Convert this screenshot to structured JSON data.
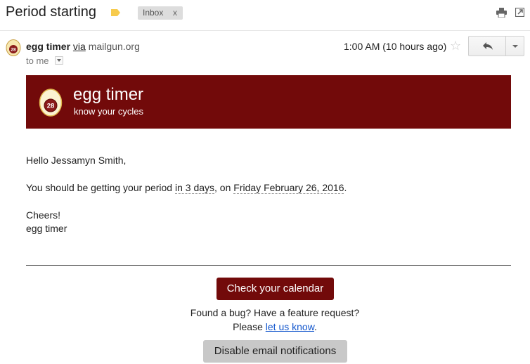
{
  "email": {
    "subject": "Period starting",
    "label_chip": "Inbox",
    "label_chip_close": "x",
    "sender_name": "egg timer",
    "via": "via",
    "sender_domain": "mailgun.org",
    "recipient": "to me",
    "timestamp": "1:00 AM (10 hours ago)"
  },
  "banner": {
    "title": "egg timer",
    "subtitle": "know your cycles",
    "logo_number": "28",
    "background": "#720a0a"
  },
  "message": {
    "greeting": "Hello Jessamyn Smith,",
    "notice_prefix": "You should be getting your period ",
    "notice_in": "in 3 days",
    "notice_middle": ", on ",
    "notice_date": "Friday February 26, 2016",
    "notice_suffix": ".",
    "cheers": "Cheers!",
    "signoff": "egg timer"
  },
  "footer": {
    "calendar_button": "Check your calendar",
    "bug_line": "Found a bug? Have a feature request?",
    "please": "Please ",
    "let_us_know": "let us know",
    "period": ".",
    "disable_button": "Disable email notifications"
  },
  "icons": [
    "label-tag-icon",
    "print-icon",
    "new-window-icon",
    "egg-timer-avatar",
    "star-icon",
    "reply-icon",
    "more-options-icon"
  ],
  "colors": {
    "brand": "#720a0a",
    "label_tag": "#f7cb4d",
    "link": "#1155cc",
    "disable_button": "#c8c8c8"
  }
}
